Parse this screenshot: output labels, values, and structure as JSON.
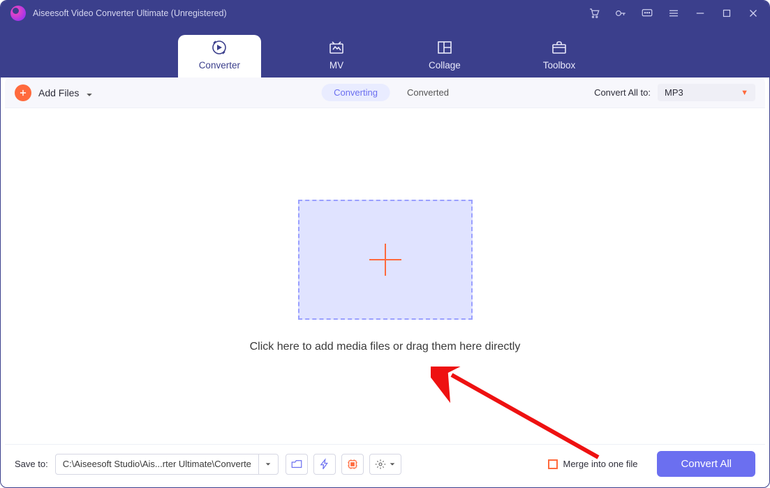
{
  "title": "Aiseesoft Video Converter Ultimate (Unregistered)",
  "nav": {
    "converter": "Converter",
    "mv": "MV",
    "collage": "Collage",
    "toolbox": "Toolbox"
  },
  "toolbar": {
    "add_files": "Add Files",
    "converting": "Converting",
    "converted": "Converted",
    "convert_all_to_label": "Convert All to:",
    "format_selected": "MP3"
  },
  "drop": {
    "caption": "Click here to add media files or drag them here directly"
  },
  "footer": {
    "save_to_label": "Save to:",
    "save_path": "C:\\Aiseesoft Studio\\Ais...rter Ultimate\\Converted",
    "merge_label": "Merge into one file",
    "convert_all": "Convert All"
  }
}
